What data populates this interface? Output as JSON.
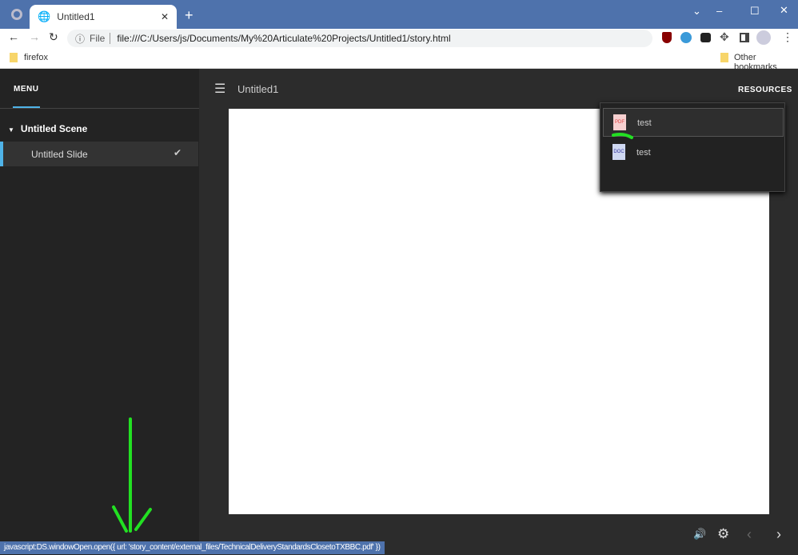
{
  "browser": {
    "tab_title": "Untitled1",
    "url_scheme": "File",
    "url": "file:///C:/Users/js/Documents/My%20Articulate%20Projects/Untitled1/story.html",
    "bookmarks": [
      {
        "label": "firefox"
      }
    ],
    "other_bookmarks": "Other bookmarks",
    "status_text": "javascript:DS.windowOpen.open({ url: 'story_content/external_files/TechnicalDeliveryStandardsClosetoTXBBC.pdf' })"
  },
  "player": {
    "menu_tab": "MENU",
    "title": "Untitled1",
    "resources_label": "RESOURCES",
    "scenes": [
      {
        "label": "Untitled Scene",
        "slides": [
          {
            "label": "Untitled Slide",
            "visited": true
          }
        ]
      }
    ],
    "resources": [
      {
        "label": "test",
        "type": "PDF"
      },
      {
        "label": "test",
        "type": "DOC"
      }
    ]
  },
  "colors": {
    "titlebar": "#4e72ac",
    "accent": "#4fb3e8",
    "annotation": "#22e022"
  }
}
